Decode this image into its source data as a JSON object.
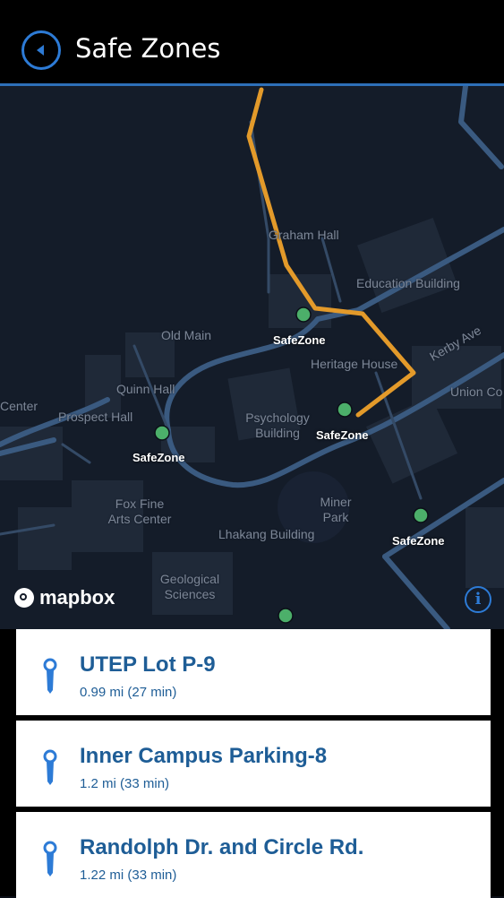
{
  "header": {
    "title": "Safe Zones",
    "back_icon": "back-arrow-circle-icon"
  },
  "colors": {
    "accent": "#2d7bd6",
    "route": "#e39a2a",
    "safezone_dot": "#4caf6a",
    "card_text": "#1e5d96"
  },
  "map": {
    "labels": {
      "graham_hall": "Graham Hall",
      "education_building": "Education Building",
      "old_main": "Old Main",
      "heritage_house": "Heritage House",
      "kerby_ave": "Kerby Ave",
      "union": "Union Co",
      "center": "Center",
      "quinn_hall": "Quinn Hall",
      "prospect_hall": "Prospect Hall",
      "psychology_building": "Psychology Building",
      "fox_fine_arts": "Fox Fine Arts Center",
      "miner_park": "Miner Park",
      "lhakang_building": "Lhakang Building",
      "geological_sciences": "Geological Sciences"
    },
    "safezone_label": "SafeZone",
    "attribution": "mapbox",
    "info_label": "i"
  },
  "locations": [
    {
      "name": "UTEP Lot P-9",
      "detail": "0.99 mi (27 min)"
    },
    {
      "name": "Inner Campus Parking-8",
      "detail": "1.2 mi (33 min)"
    },
    {
      "name": "Randolph Dr. and Circle Rd.",
      "detail": "1.22 mi (33 min)"
    }
  ]
}
